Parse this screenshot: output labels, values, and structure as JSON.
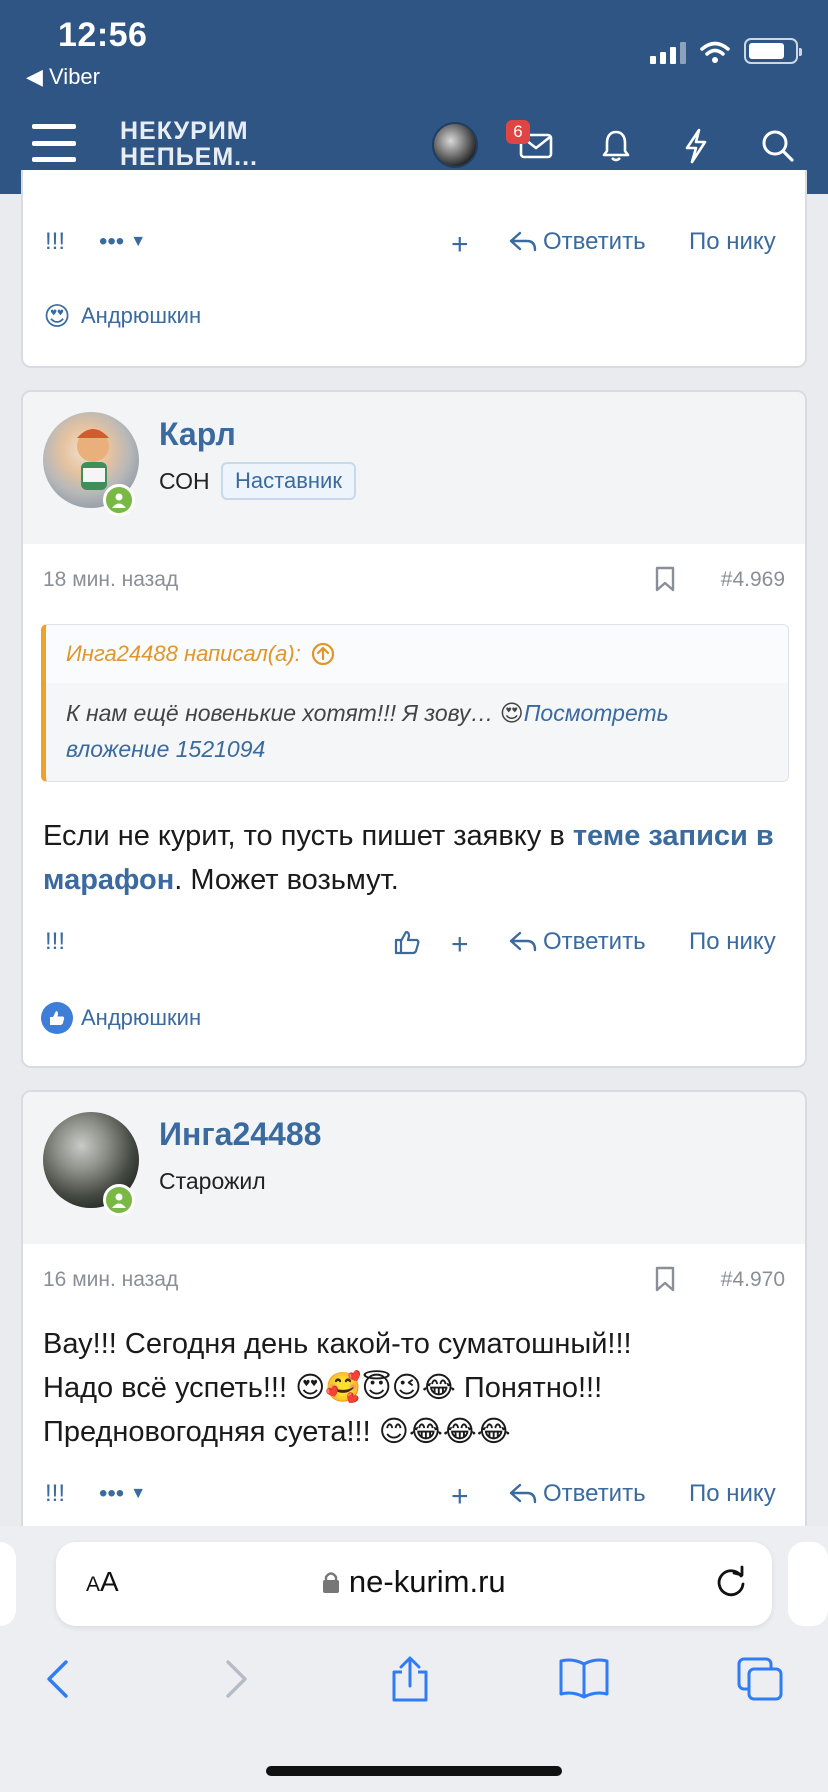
{
  "status": {
    "time": "12:56",
    "back_app": "◀ Viber"
  },
  "header": {
    "logo_line1": "НЕКУРИМ",
    "logo_line2": "НЕПЬЕМ...",
    "notifications_count": "6"
  },
  "actions": {
    "exclaim": "!!!",
    "more": "•••",
    "plus": "+",
    "reply": "Ответить",
    "by_nick": "По нику"
  },
  "prev_post": {
    "reaction_user": "Андрюшкин"
  },
  "posts": [
    {
      "author": "Карл",
      "user_title": "СОН",
      "banner": "Наставник",
      "time": "18 мин. назад",
      "number": "#4.969",
      "quote": {
        "author_line": "Инга24488 написал(а):",
        "text": "К нам ещё новенькие хотят!!! Я зову… 😍",
        "link": "Посмотреть вложение 1521094"
      },
      "body_prefix": "Если не курит, то пусть пишет заявку в ",
      "body_link": "теме записи в марафон",
      "body_suffix": ". Может возьмут.",
      "reaction_user": "Андрюшкин"
    },
    {
      "author": "Инга24488",
      "user_title": "Старожил",
      "time": "16 мин. назад",
      "number": "#4.970",
      "body_line1": "Вау!!! Сегодня день какой-то суматошный!!!",
      "body_line2": "Надо всё успеть!!! 😍🥰😇😉😂 Понятно!!!",
      "body_line3": "Предновогодняя суета!!! 😊😂😂😂"
    }
  ],
  "browser": {
    "aa": "AA",
    "url": "ne-kurim.ru"
  },
  "colors": {
    "header": "#2e5583",
    "link": "#3a6a9e",
    "quote_accent": "#f0a02e",
    "online": "#7ab846"
  }
}
